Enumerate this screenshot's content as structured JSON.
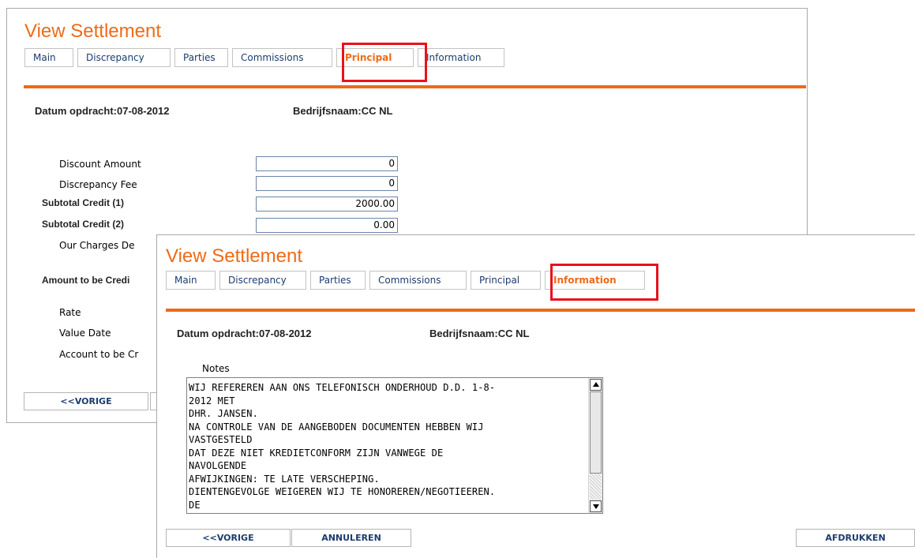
{
  "back_window": {
    "title": "View Settlement",
    "tabs": [
      "Main",
      "Discrepancy",
      "Parties",
      "Commissions",
      "Principal",
      "Information"
    ],
    "active_tab": "Principal",
    "datum": "Datum opdracht:07-08-2012",
    "bedrijf": "Bedrijfsnaam:CC NL",
    "fields": {
      "discount_amount": {
        "label": "Discount Amount",
        "value": "0"
      },
      "discrepancy_fee": {
        "label": "Discrepancy Fee",
        "value": "0"
      },
      "subtotal_credit_1": {
        "label": "Subtotal Credit (1)",
        "value": "2000.00"
      },
      "subtotal_credit_2": {
        "label": "Subtotal Credit (2)",
        "value": "0.00"
      },
      "our_charges": {
        "label": "Our Charges De"
      },
      "amount_credited": {
        "label": "Amount to be Credi"
      },
      "rate": {
        "label": "Rate"
      },
      "value_date": {
        "label": "Value Date"
      },
      "account_credited": {
        "label": "Account to be Cr"
      }
    },
    "buttons": {
      "vorige": "<<VORIGE"
    }
  },
  "front_window": {
    "title": "View Settlement",
    "tabs": [
      "Main",
      "Discrepancy",
      "Parties",
      "Commissions",
      "Principal",
      "Information"
    ],
    "active_tab": "Information",
    "datum": "Datum opdracht:07-08-2012",
    "bedrijf": "Bedrijfsnaam:CC NL",
    "notes_label": "Notes",
    "notes_text": "WIJ REFEREREN AAN ONS TELEFONISCH ONDERHOUD D.D. 1-8-\n2012 MET\nDHR. JANSEN.\nNA CONTROLE VAN DE AANGEBODEN DOCUMENTEN HEBBEN WIJ\nVASTGESTELD\nDAT DEZE NIET KREDIETCONFORM ZIJN VANWEGE DE\nNAVOLGENDE\nAFWIJKINGEN: TE LATE VERSCHEPING.\nDIENTENGEVOLGE WEIGEREN WIJ TE HONOREREN/NEGOTIEEREN.\nDE",
    "buttons": {
      "vorige": "<<VORIGE",
      "annuleren": "ANNULEREN",
      "afdrukken": "AFDRUKKEN"
    }
  },
  "colors": {
    "accent": "#ee6a18",
    "highlight": "#e8121c",
    "link": "#1c3c6e"
  }
}
